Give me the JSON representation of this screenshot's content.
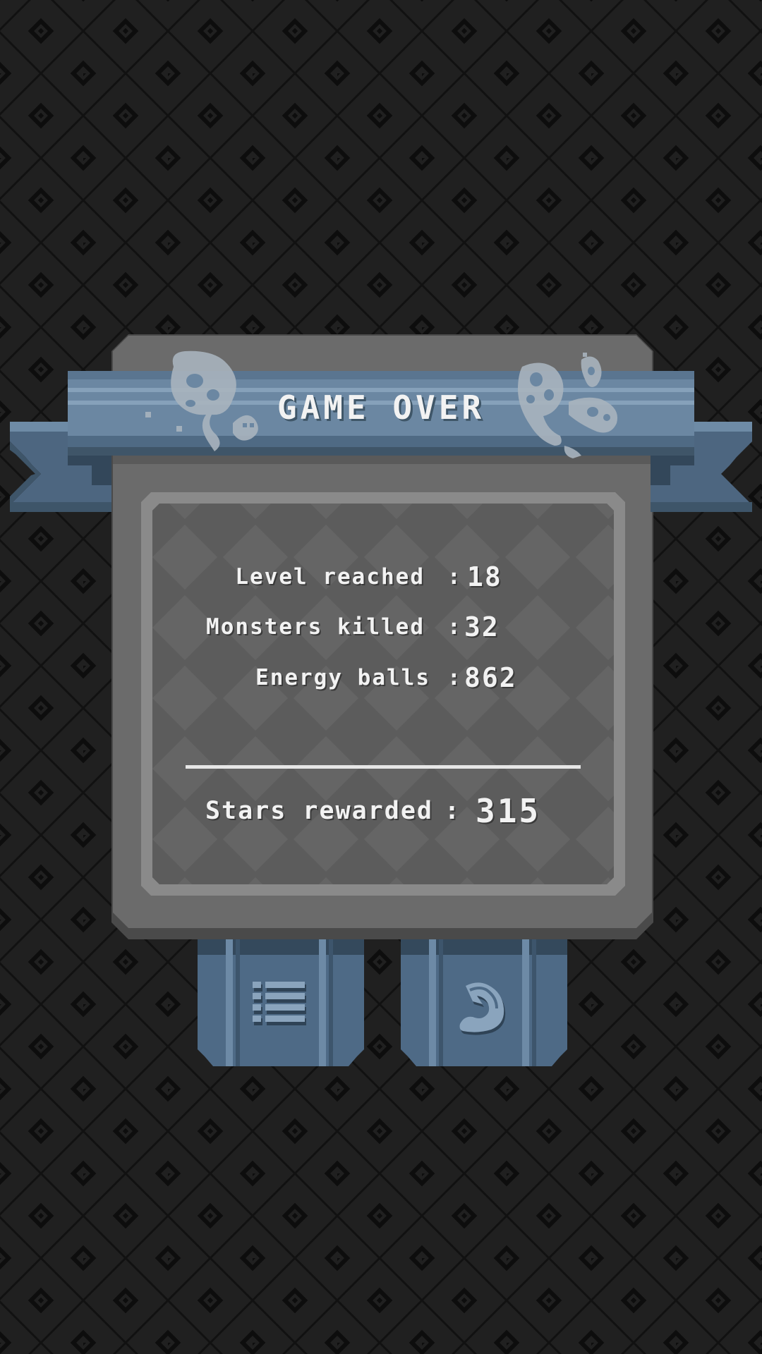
{
  "screen": {
    "title": "GAME OVER"
  },
  "stats": [
    {
      "label": "Level reached",
      "colon": ":",
      "value": "18"
    },
    {
      "label": "Monsters killed",
      "colon": ":",
      "value": "32"
    },
    {
      "label": "Energy balls",
      "colon": ":",
      "value": "862"
    }
  ],
  "reward": {
    "label": "Stars rewarded",
    "colon": ":",
    "value": "315"
  },
  "buttons": {
    "menu_icon": "list-menu-icon",
    "next_icon": "curved-arrow-next-icon"
  },
  "colors": {
    "background": "#202020",
    "panel": "#6b6b6b",
    "screen": "#5c5c5c",
    "ribbon": "#6d8aa6",
    "button": "#4e6a86",
    "text": "#f2f2f2"
  }
}
